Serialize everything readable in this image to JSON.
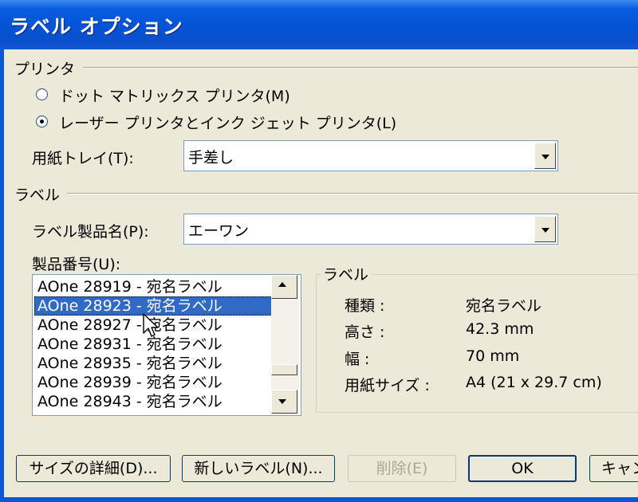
{
  "window": {
    "title": "ラベル オプション"
  },
  "printer": {
    "group_label": "プリンタ",
    "radio_dot_matrix": "ドット マトリックス プリンタ(M)",
    "radio_laser": "レーザー プリンタとインク ジェット プリンタ(L)",
    "selected": "laser",
    "tray_label": "用紙トレイ(T):",
    "tray_value": "手差し"
  },
  "label": {
    "group_label": "ラベル",
    "product_name_label": "ラベル製品名(P):",
    "product_name_value": "エーワン",
    "product_number_label": "製品番号(U):",
    "product_numbers": [
      "AOne 28919 - 宛名ラベル",
      "AOne 28923 - 宛名ラベル",
      "AOne 28927 - 宛名ラベル",
      "AOne 28931 - 宛名ラベル",
      "AOne 28935 - 宛名ラベル",
      "AOne 28939 - 宛名ラベル",
      "AOne 28943 - 宛名ラベル"
    ],
    "selected_product": "AOne 28923 - 宛名ラベル"
  },
  "info": {
    "group_label": "ラベル",
    "type_key": "種類 :",
    "type_value": "宛名ラベル",
    "height_key": "高さ :",
    "height_value": "42.3 mm",
    "width_key": "幅 :",
    "width_value": "70 mm",
    "paper_key": "用紙サイズ :",
    "paper_value": "A4 (21 x 29.7 cm)"
  },
  "buttons": {
    "details": "サイズの詳細(D)...",
    "new_label": "新しいラベル(N)...",
    "delete": "削除(E)",
    "ok": "OK",
    "cancel": "キャンセル"
  },
  "colors": {
    "titlebar": "#0453d6",
    "selection": "#316ac5",
    "dialog_bg": "#ece9d8"
  }
}
